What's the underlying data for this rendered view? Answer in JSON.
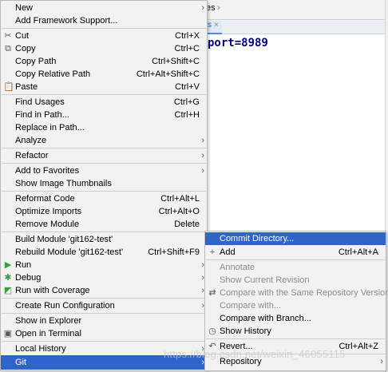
{
  "editor": {
    "breadcrumb": "es",
    "tab_label": "s",
    "code_line": "port=8989"
  },
  "menu": {
    "new": {
      "label": "New"
    },
    "add_framework": {
      "label": "Add Framework Support..."
    },
    "cut": {
      "label": "Cut",
      "shortcut": "Ctrl+X"
    },
    "copy": {
      "label": "Copy",
      "shortcut": "Ctrl+C"
    },
    "copy_path": {
      "label": "Copy Path",
      "shortcut": "Ctrl+Shift+C"
    },
    "copy_relative_path": {
      "label": "Copy Relative Path",
      "shortcut": "Ctrl+Alt+Shift+C"
    },
    "paste": {
      "label": "Paste",
      "shortcut": "Ctrl+V"
    },
    "find_usages": {
      "label": "Find Usages",
      "shortcut": "Ctrl+G"
    },
    "find_in_path": {
      "label": "Find in Path...",
      "shortcut": "Ctrl+H"
    },
    "replace_in_path": {
      "label": "Replace in Path..."
    },
    "analyze": {
      "label": "Analyze"
    },
    "refactor": {
      "label": "Refactor"
    },
    "add_to_favorites": {
      "label": "Add to Favorites"
    },
    "show_image_thumbnails": {
      "label": "Show Image Thumbnails"
    },
    "reformat_code": {
      "label": "Reformat Code",
      "shortcut": "Ctrl+Alt+L"
    },
    "optimize_imports": {
      "label": "Optimize Imports",
      "shortcut": "Ctrl+Alt+O"
    },
    "remove_module": {
      "label": "Remove Module",
      "shortcut": "Delete"
    },
    "build_module": {
      "label": "Build Module 'git162-test'"
    },
    "rebuild_module": {
      "label": "Rebuild Module 'git162-test'",
      "shortcut": "Ctrl+Shift+F9"
    },
    "run": {
      "label": "Run"
    },
    "debug": {
      "label": "Debug"
    },
    "run_with_coverage": {
      "label": "Run with Coverage"
    },
    "create_run_config": {
      "label": "Create Run Configuration"
    },
    "show_in_explorer": {
      "label": "Show in Explorer"
    },
    "open_in_terminal": {
      "label": "Open in Terminal"
    },
    "local_history": {
      "label": "Local History"
    },
    "git": {
      "label": "Git"
    }
  },
  "git_submenu": {
    "commit_directory": {
      "label": "Commit Directory..."
    },
    "add": {
      "label": "Add",
      "shortcut": "Ctrl+Alt+A"
    },
    "annotate": {
      "label": "Annotate"
    },
    "show_current_revision": {
      "label": "Show Current Revision"
    },
    "compare_same_repo": {
      "label": "Compare with the Same Repository Version"
    },
    "compare_with": {
      "label": "Compare with..."
    },
    "compare_with_branch": {
      "label": "Compare with Branch..."
    },
    "show_history": {
      "label": "Show History"
    },
    "revert": {
      "label": "Revert...",
      "shortcut": "Ctrl+Alt+Z"
    },
    "repository": {
      "label": "Repository"
    }
  },
  "watermark": "https://blog.csdn.net/weixin_46055115",
  "colors": {
    "highlight": "#2f65ca",
    "menu_bg": "#f2f2f2",
    "code_keyword": "#000080",
    "run_icon": "#3c9d3c",
    "disabled_text": "#8c8c8c"
  }
}
